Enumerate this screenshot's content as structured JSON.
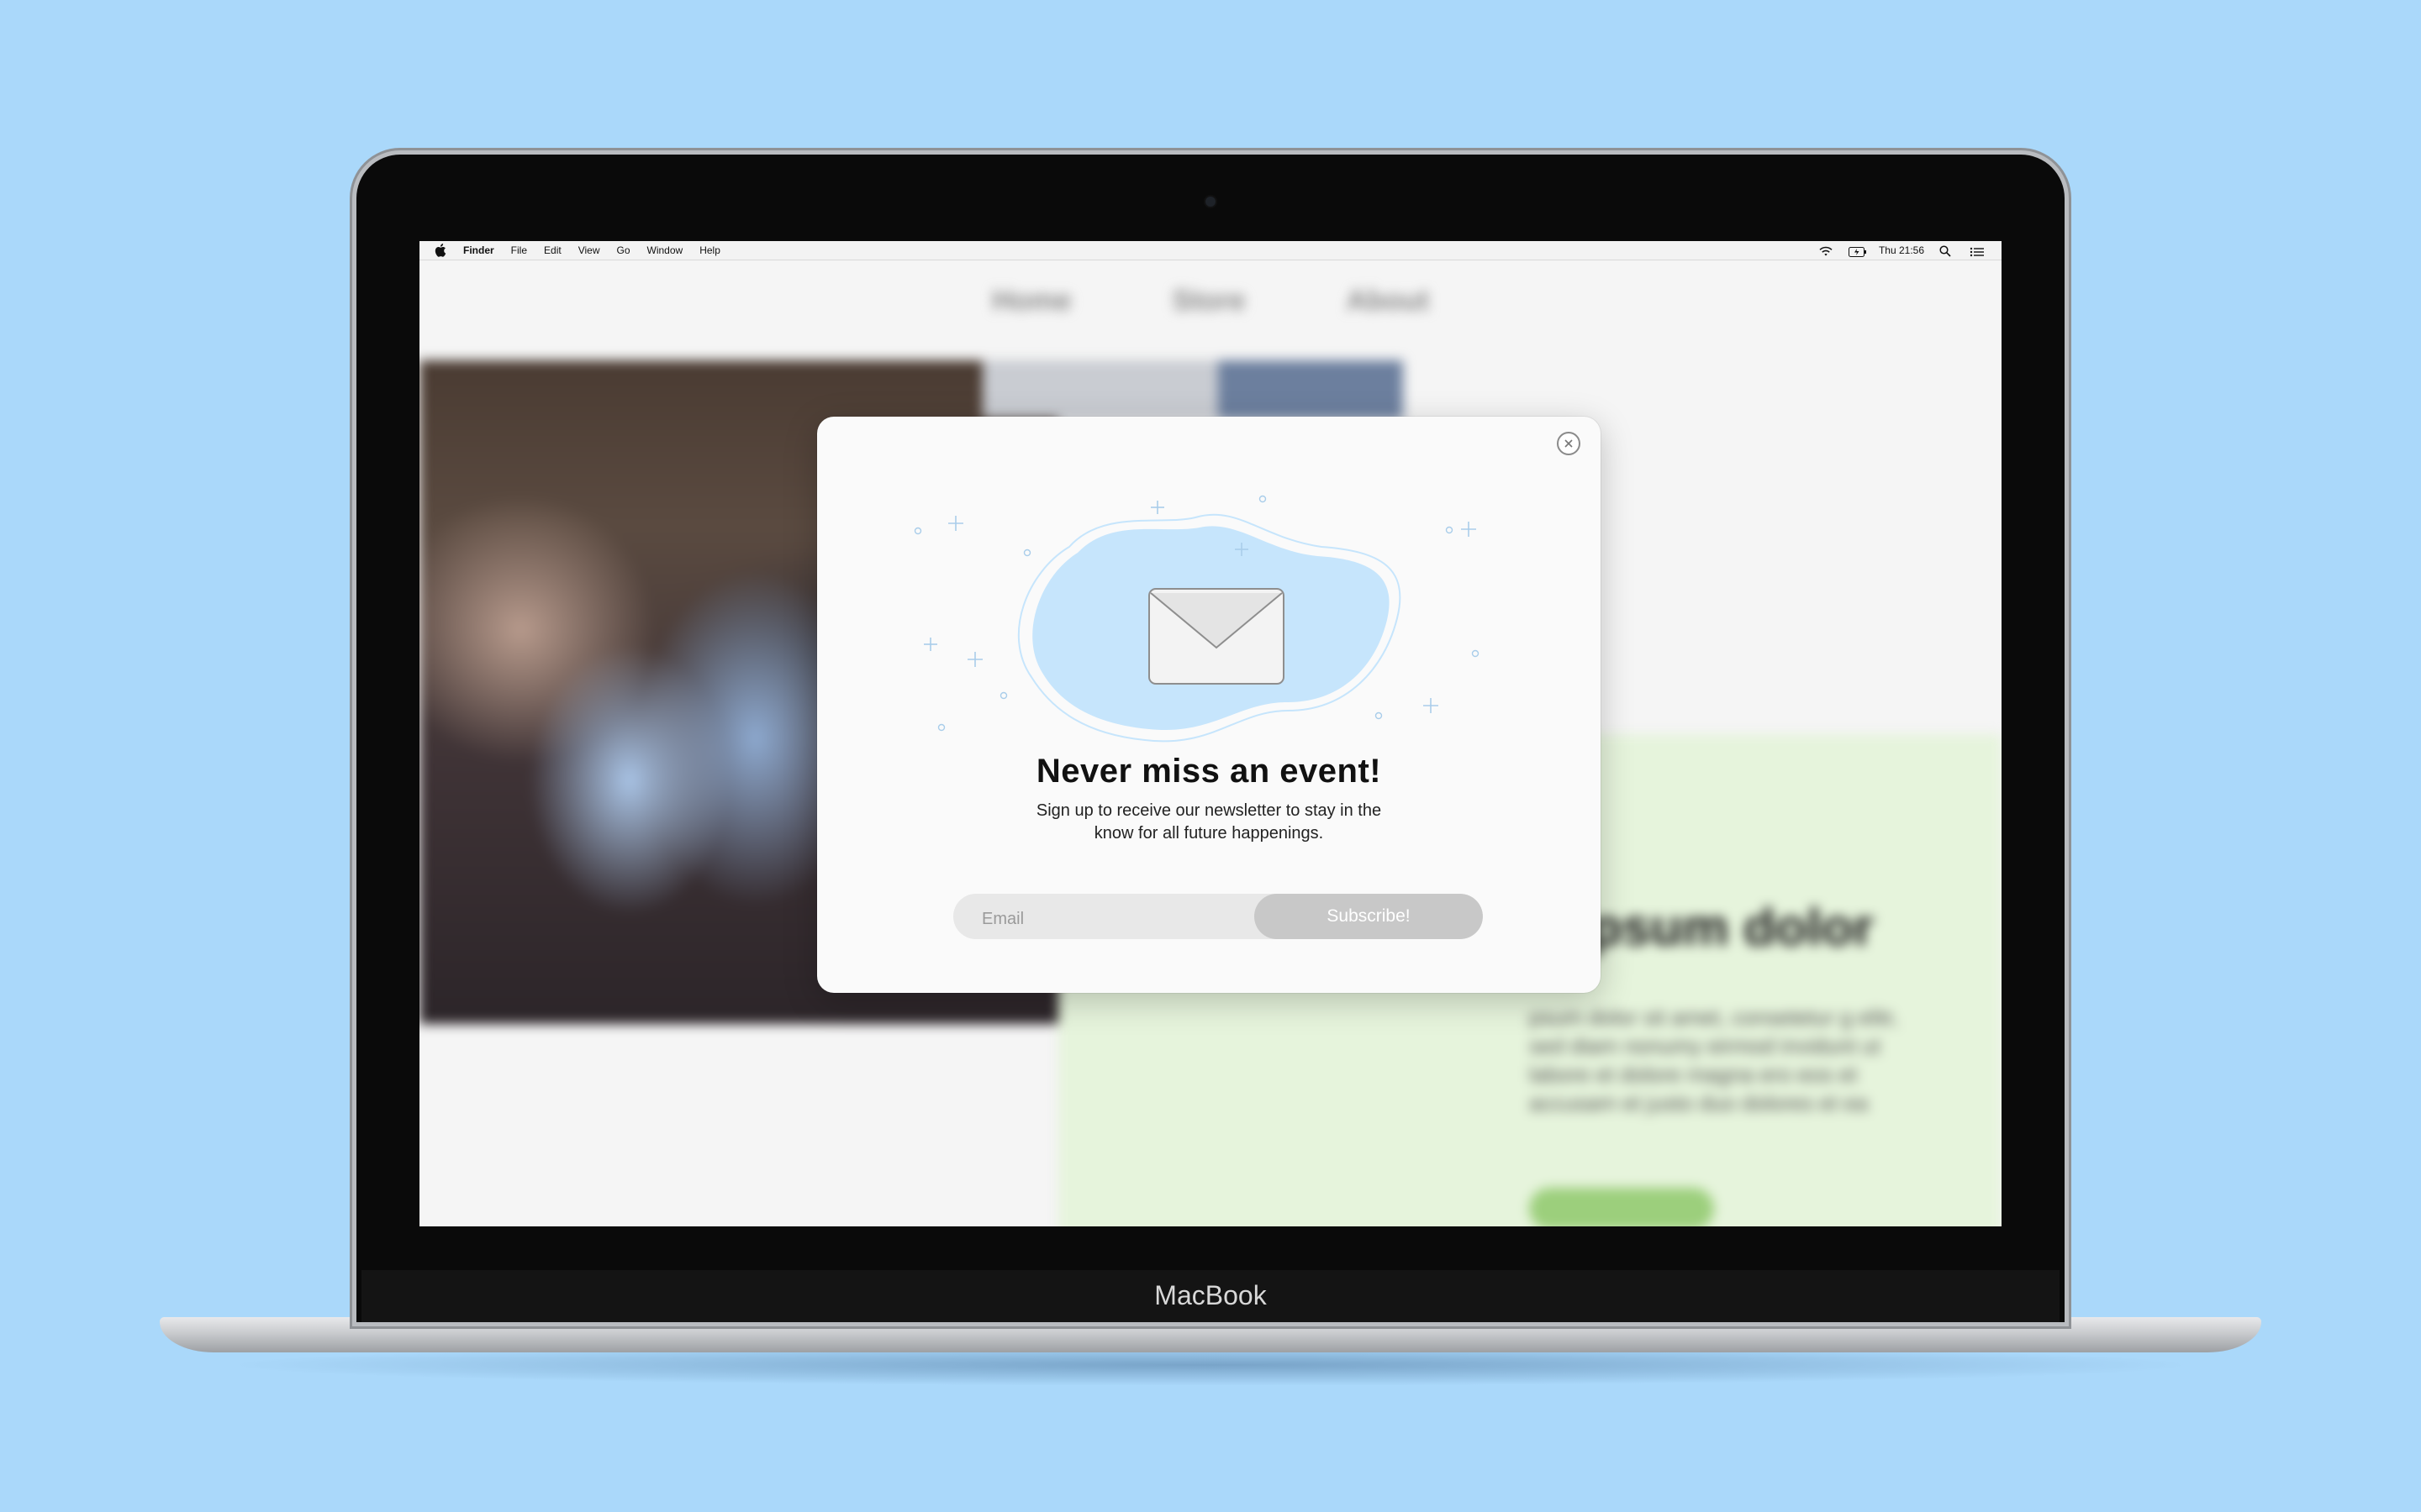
{
  "menubar": {
    "app_name": "Finder",
    "menus": [
      "File",
      "Edit",
      "View",
      "Go",
      "Window",
      "Help"
    ],
    "clock": "Thu 21:56"
  },
  "laptop": {
    "brand": "MacBook"
  },
  "background_page": {
    "nav": [
      "Home",
      "Store",
      "About"
    ],
    "heading": "n ipsum dolor",
    "paragraph": "psum dolor sit amet, consetetur g elitr, sed diam nonumy eirmod invidunt ut labore et dolore magna ero eos et accusam et justo duo dolores et ea"
  },
  "modal": {
    "title": "Never miss an event!",
    "description": "Sign up to receive our newsletter to stay in the know for all future happenings.",
    "email_placeholder": "Email",
    "subscribe_label": "Subscribe!"
  },
  "colors": {
    "background": "#aad8fa",
    "blob": "#c6e5fc",
    "subscribe_button": "#c8c8c8",
    "green_card": "#e6f4dc"
  }
}
